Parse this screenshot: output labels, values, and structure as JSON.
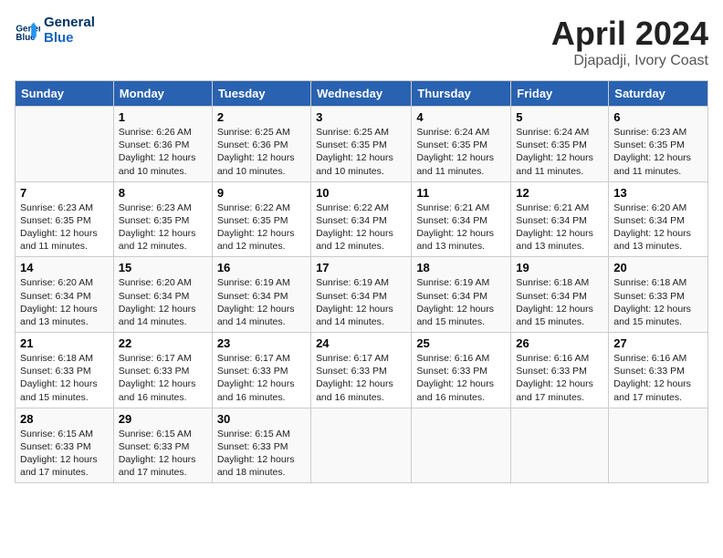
{
  "header": {
    "logo_line1": "General",
    "logo_line2": "Blue",
    "month": "April 2024",
    "location": "Djapadji, Ivory Coast"
  },
  "days_of_week": [
    "Sunday",
    "Monday",
    "Tuesday",
    "Wednesday",
    "Thursday",
    "Friday",
    "Saturday"
  ],
  "weeks": [
    [
      {
        "day": "",
        "info": ""
      },
      {
        "day": "1",
        "info": "Sunrise: 6:26 AM\nSunset: 6:36 PM\nDaylight: 12 hours\nand 10 minutes."
      },
      {
        "day": "2",
        "info": "Sunrise: 6:25 AM\nSunset: 6:36 PM\nDaylight: 12 hours\nand 10 minutes."
      },
      {
        "day": "3",
        "info": "Sunrise: 6:25 AM\nSunset: 6:35 PM\nDaylight: 12 hours\nand 10 minutes."
      },
      {
        "day": "4",
        "info": "Sunrise: 6:24 AM\nSunset: 6:35 PM\nDaylight: 12 hours\nand 11 minutes."
      },
      {
        "day": "5",
        "info": "Sunrise: 6:24 AM\nSunset: 6:35 PM\nDaylight: 12 hours\nand 11 minutes."
      },
      {
        "day": "6",
        "info": "Sunrise: 6:23 AM\nSunset: 6:35 PM\nDaylight: 12 hours\nand 11 minutes."
      }
    ],
    [
      {
        "day": "7",
        "info": "Sunrise: 6:23 AM\nSunset: 6:35 PM\nDaylight: 12 hours\nand 11 minutes."
      },
      {
        "day": "8",
        "info": "Sunrise: 6:23 AM\nSunset: 6:35 PM\nDaylight: 12 hours\nand 12 minutes."
      },
      {
        "day": "9",
        "info": "Sunrise: 6:22 AM\nSunset: 6:35 PM\nDaylight: 12 hours\nand 12 minutes."
      },
      {
        "day": "10",
        "info": "Sunrise: 6:22 AM\nSunset: 6:34 PM\nDaylight: 12 hours\nand 12 minutes."
      },
      {
        "day": "11",
        "info": "Sunrise: 6:21 AM\nSunset: 6:34 PM\nDaylight: 12 hours\nand 13 minutes."
      },
      {
        "day": "12",
        "info": "Sunrise: 6:21 AM\nSunset: 6:34 PM\nDaylight: 12 hours\nand 13 minutes."
      },
      {
        "day": "13",
        "info": "Sunrise: 6:20 AM\nSunset: 6:34 PM\nDaylight: 12 hours\nand 13 minutes."
      }
    ],
    [
      {
        "day": "14",
        "info": "Sunrise: 6:20 AM\nSunset: 6:34 PM\nDaylight: 12 hours\nand 13 minutes."
      },
      {
        "day": "15",
        "info": "Sunrise: 6:20 AM\nSunset: 6:34 PM\nDaylight: 12 hours\nand 14 minutes."
      },
      {
        "day": "16",
        "info": "Sunrise: 6:19 AM\nSunset: 6:34 PM\nDaylight: 12 hours\nand 14 minutes."
      },
      {
        "day": "17",
        "info": "Sunrise: 6:19 AM\nSunset: 6:34 PM\nDaylight: 12 hours\nand 14 minutes."
      },
      {
        "day": "18",
        "info": "Sunrise: 6:19 AM\nSunset: 6:34 PM\nDaylight: 12 hours\nand 15 minutes."
      },
      {
        "day": "19",
        "info": "Sunrise: 6:18 AM\nSunset: 6:34 PM\nDaylight: 12 hours\nand 15 minutes."
      },
      {
        "day": "20",
        "info": "Sunrise: 6:18 AM\nSunset: 6:33 PM\nDaylight: 12 hours\nand 15 minutes."
      }
    ],
    [
      {
        "day": "21",
        "info": "Sunrise: 6:18 AM\nSunset: 6:33 PM\nDaylight: 12 hours\nand 15 minutes."
      },
      {
        "day": "22",
        "info": "Sunrise: 6:17 AM\nSunset: 6:33 PM\nDaylight: 12 hours\nand 16 minutes."
      },
      {
        "day": "23",
        "info": "Sunrise: 6:17 AM\nSunset: 6:33 PM\nDaylight: 12 hours\nand 16 minutes."
      },
      {
        "day": "24",
        "info": "Sunrise: 6:17 AM\nSunset: 6:33 PM\nDaylight: 12 hours\nand 16 minutes."
      },
      {
        "day": "25",
        "info": "Sunrise: 6:16 AM\nSunset: 6:33 PM\nDaylight: 12 hours\nand 16 minutes."
      },
      {
        "day": "26",
        "info": "Sunrise: 6:16 AM\nSunset: 6:33 PM\nDaylight: 12 hours\nand 17 minutes."
      },
      {
        "day": "27",
        "info": "Sunrise: 6:16 AM\nSunset: 6:33 PM\nDaylight: 12 hours\nand 17 minutes."
      }
    ],
    [
      {
        "day": "28",
        "info": "Sunrise: 6:15 AM\nSunset: 6:33 PM\nDaylight: 12 hours\nand 17 minutes."
      },
      {
        "day": "29",
        "info": "Sunrise: 6:15 AM\nSunset: 6:33 PM\nDaylight: 12 hours\nand 17 minutes."
      },
      {
        "day": "30",
        "info": "Sunrise: 6:15 AM\nSunset: 6:33 PM\nDaylight: 12 hours\nand 18 minutes."
      },
      {
        "day": "",
        "info": ""
      },
      {
        "day": "",
        "info": ""
      },
      {
        "day": "",
        "info": ""
      },
      {
        "day": "",
        "info": ""
      }
    ]
  ]
}
